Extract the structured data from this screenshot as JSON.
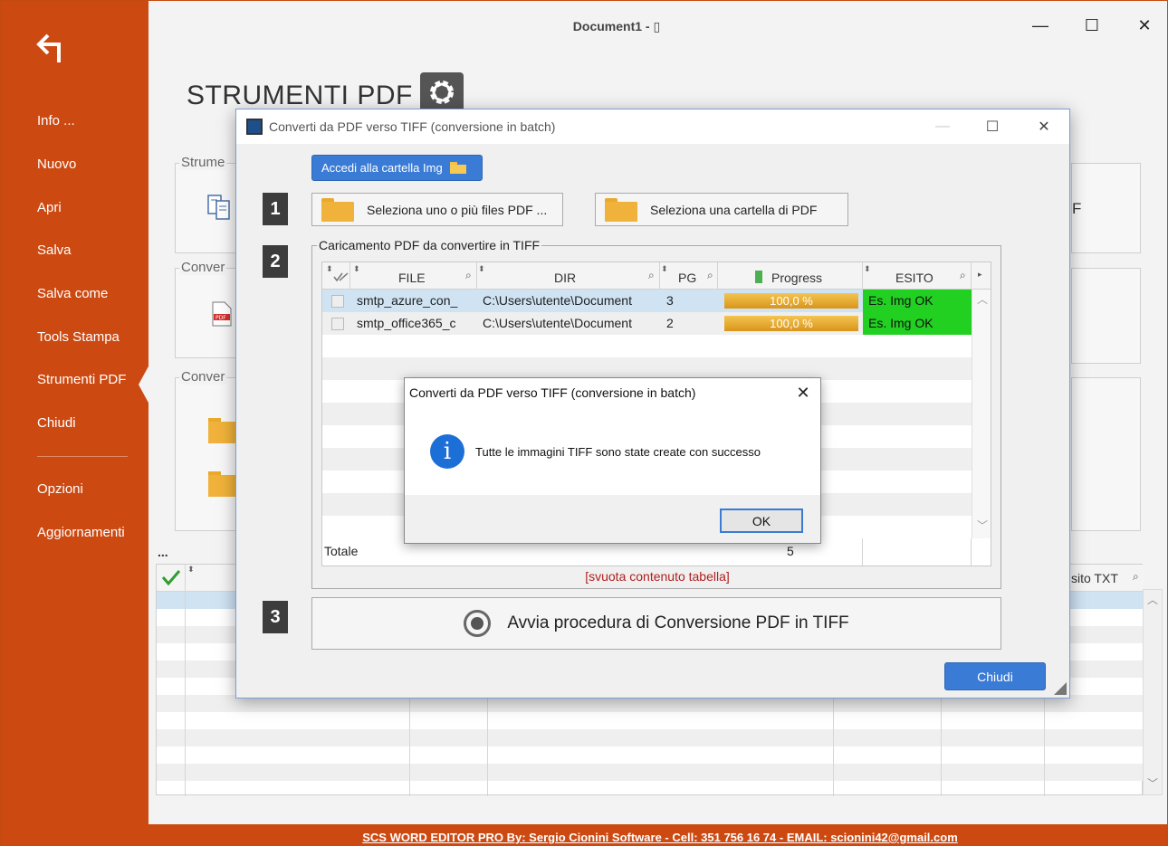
{
  "window": {
    "title": "Document1 - ▯",
    "minimize": "—",
    "maximize": "☐",
    "close": "✕"
  },
  "sidebar": {
    "items": [
      {
        "label": "Info ..."
      },
      {
        "label": "Nuovo"
      },
      {
        "label": "Apri"
      },
      {
        "label": "Salva"
      },
      {
        "label": "Salva come"
      },
      {
        "label": "Tools Stampa"
      },
      {
        "label": "Strumenti PDF"
      },
      {
        "label": "Chiudi"
      },
      {
        "label": "Opzioni"
      },
      {
        "label": "Aggiornamenti"
      }
    ],
    "active": "Strumenti PDF"
  },
  "page": {
    "heading": "STRUMENTI PDF",
    "groups": [
      {
        "label": "Strume"
      },
      {
        "label": "Conver"
      },
      {
        "label": "Conver"
      }
    ],
    "right_fragment": "F",
    "ellipsis": "...",
    "grid_header_fragment": "sito TXT"
  },
  "status_bar": {
    "text": "SCS WORD EDITOR PRO By: Sergio Cionini Software - Cell: 351 756 16 74 - EMAIL: scionini42@gmail.com"
  },
  "dialog": {
    "title": "Converti da PDF verso TIFF (conversione in batch)",
    "open_folder_button": "Accedi alla cartella Img",
    "steps": [
      "1",
      "2",
      "3"
    ],
    "select_files_button": "Seleziona uno o più files PDF ...",
    "select_folder_button": "Seleziona una cartella di PDF",
    "group_label": "Caricamento PDF da convertire in TIFF",
    "table": {
      "headers": {
        "file": "FILE",
        "dir": "DIR",
        "pg": "PG",
        "progress": "Progress",
        "esito": "ESITO"
      },
      "rows": [
        {
          "file": "smtp_azure_con_",
          "dir": "C:\\Users\\utente\\Document",
          "pg": "3",
          "progress": 100,
          "progress_text": "100,0 %",
          "esito": "Es. Img OK"
        },
        {
          "file": "smtp_office365_c",
          "dir": "C:\\Users\\utente\\Document",
          "pg": "2",
          "progress": 100,
          "progress_text": "100,0 %",
          "esito": "Es. Img OK"
        }
      ],
      "total_label": "Totale",
      "total_value": "5"
    },
    "clear_link": "[svuota contenuto tabella]",
    "run_button": "Avvia procedura di Conversione PDF in TIFF",
    "close_button": "Chiudi"
  },
  "message_box": {
    "title": "Converti da PDF verso TIFF (conversione in batch)",
    "close": "✕",
    "icon_glyph": "i",
    "text": "Tutte le immagini TIFF sono state create con successo",
    "ok_button": "OK"
  },
  "colors": {
    "sidebar": "#cc4a12",
    "accent_blue": "#3a7bd5",
    "success_green": "#22d022",
    "progress_orange": "#e0a020"
  }
}
